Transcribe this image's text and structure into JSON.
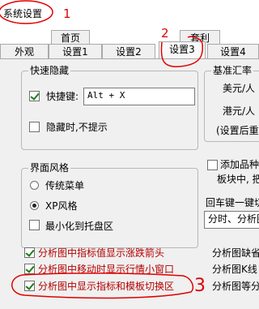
{
  "window": {
    "title": "系统设置"
  },
  "tabs_back": [
    {
      "label": "首页"
    },
    {
      "label": "套利"
    }
  ],
  "tabs_front": [
    {
      "label": "外观"
    },
    {
      "label": "设置1"
    },
    {
      "label": "设置2"
    },
    {
      "label": "设置3"
    },
    {
      "label": "设置4"
    }
  ],
  "quick_hide": {
    "title": "快速隐藏",
    "hotkey_label": "快捷键:",
    "hotkey_checked": true,
    "hotkey_value": "Alt + X",
    "no_prompt_label": "隐藏时,不提示",
    "no_prompt_checked": false
  },
  "interface_style": {
    "title": "界面风格",
    "options": [
      {
        "label": "传统菜单",
        "selected": false
      },
      {
        "label": "XP风格",
        "selected": true
      }
    ],
    "minimize_tray_label": "最小化到托盘区",
    "minimize_tray_checked": false
  },
  "exchange_rate": {
    "title": "基准汇率",
    "usd_label": "美元/人",
    "hkd_label": "港元/人",
    "settings_note": "(设置后重"
  },
  "add_variety": {
    "label_line1": "添加品种",
    "label_line2": "板块中, 把",
    "checked": false
  },
  "enter_key": {
    "label": "回车键一键切",
    "select_value": "分时、分析图"
  },
  "bottom_options": [
    {
      "label": "分析图中指标值显示涨跌箭头",
      "checked": true
    },
    {
      "label": "分析图中移动时显示行情小窗口",
      "checked": true
    },
    {
      "label": "分析图中显示指标和模板切换区",
      "checked": true
    }
  ],
  "bottom_right_labels": [
    {
      "label": "分析图缺省"
    },
    {
      "label": "分析图K线"
    },
    {
      "label": "分析图等分"
    }
  ],
  "annotations": {
    "mark1": "1",
    "mark2": "2",
    "mark3": "3",
    "color": "#e00000"
  }
}
